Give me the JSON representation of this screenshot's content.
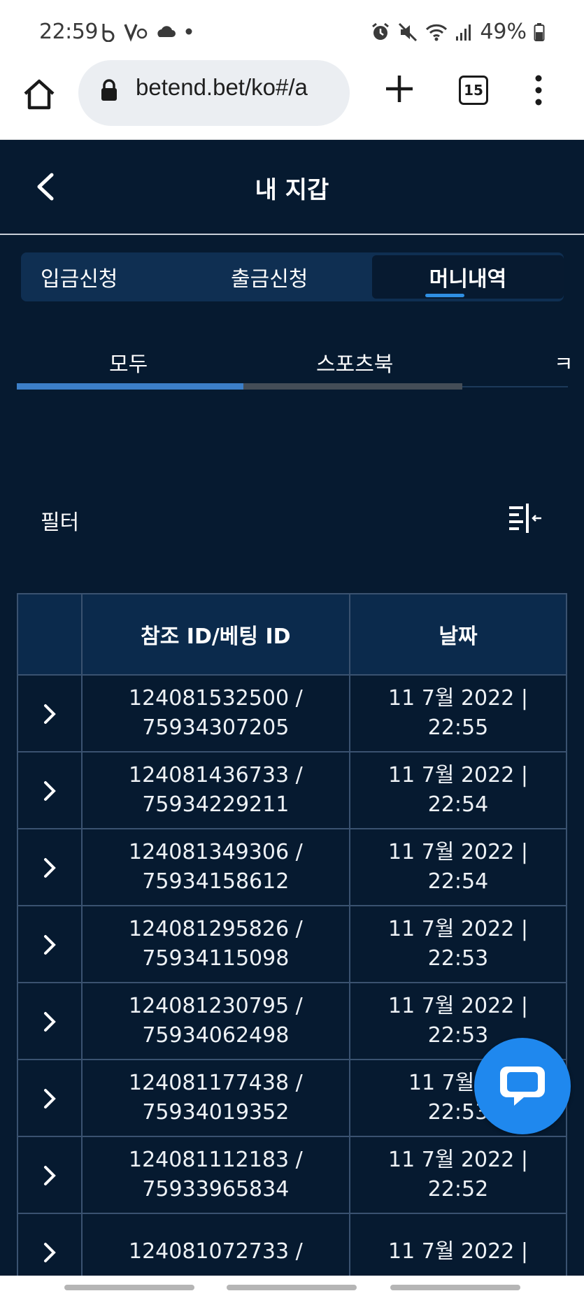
{
  "status_bar": {
    "time": "22:59",
    "battery": "49%",
    "left_icons": [
      "beta-b-icon",
      "v-icon",
      "cloud-icon",
      "dot-icon"
    ],
    "right_icons": [
      "alarm-icon",
      "mute-icon",
      "wifi-icon",
      "signal-icon",
      "battery-icon"
    ]
  },
  "browser": {
    "url": "betend.bet/ko#/a",
    "tab_count": "15"
  },
  "header": {
    "title": "내 지갑"
  },
  "main_tabs": [
    {
      "label": "입금신청",
      "active": false
    },
    {
      "label": "출금신청",
      "active": false
    },
    {
      "label": "머니내역",
      "active": true
    }
  ],
  "sub_tabs": [
    {
      "label": "모두",
      "active": true
    },
    {
      "label": "스포츠북",
      "active": false
    },
    {
      "label": "ㅋ",
      "active": false
    }
  ],
  "filter": {
    "label": "필터"
  },
  "table": {
    "columns": [
      "",
      "참조 ID/베팅 ID",
      "날짜"
    ],
    "rows": [
      {
        "ref_id": "124081532500 /",
        "bet_id": "75934307205",
        "date": "11 7월 2022 |",
        "time": "22:55"
      },
      {
        "ref_id": "124081436733 /",
        "bet_id": "75934229211",
        "date": "11 7월 2022 |",
        "time": "22:54"
      },
      {
        "ref_id": "124081349306 /",
        "bet_id": "75934158612",
        "date": "11 7월 2022 |",
        "time": "22:54"
      },
      {
        "ref_id": "124081295826 /",
        "bet_id": "75934115098",
        "date": "11 7월 2022 |",
        "time": "22:53"
      },
      {
        "ref_id": "124081230795 /",
        "bet_id": "75934062498",
        "date": "11 7월 2022 |",
        "time": "22:53"
      },
      {
        "ref_id": "124081177438 /",
        "bet_id": "75934019352",
        "date": "11 7월 20",
        "time": "22:53"
      },
      {
        "ref_id": "124081112183 /",
        "bet_id": "75933965834",
        "date": "11 7월 2022 |",
        "time": "22:52"
      },
      {
        "ref_id": "124081072733 /",
        "bet_id": "",
        "date": "11 7월 2022 |",
        "time": ""
      }
    ]
  },
  "colors": {
    "app_bg": "#061a30",
    "tab_bg": "#0f2f52",
    "accent": "#2f8fe3",
    "progress": "#3c7fc8",
    "chat_fab": "#1f88ee"
  }
}
